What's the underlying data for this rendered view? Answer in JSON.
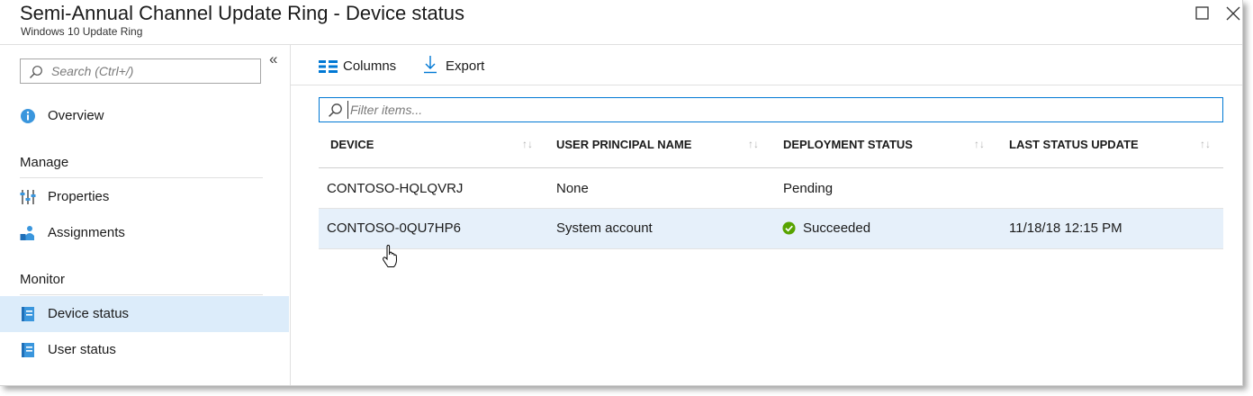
{
  "header": {
    "title": "Semi-Annual Channel Update Ring - Device status",
    "subtitle": "Windows 10 Update Ring"
  },
  "sidebar": {
    "search_placeholder": "Search (Ctrl+/)",
    "collapse_glyph": "«",
    "overview_label": "Overview",
    "sections": {
      "manage": "Manage",
      "monitor": "Monitor"
    },
    "items": [
      {
        "label": "Overview",
        "icon": "info-icon"
      },
      {
        "label": "Properties",
        "icon": "properties-icon"
      },
      {
        "label": "Assignments",
        "icon": "assignments-icon"
      },
      {
        "label": "Device status",
        "icon": "device-status-icon",
        "selected": true
      },
      {
        "label": "User status",
        "icon": "user-status-icon"
      }
    ]
  },
  "toolbar": {
    "columns_label": "Columns",
    "export_label": "Export"
  },
  "filter": {
    "placeholder": "Filter items..."
  },
  "table": {
    "columns": [
      "DEVICE",
      "USER PRINCIPAL NAME",
      "DEPLOYMENT STATUS",
      "LAST STATUS UPDATE"
    ],
    "sort_glyph": "↑↓",
    "rows": [
      {
        "device": "CONTOSO-HQLQVRJ",
        "upn": "None",
        "status": "Pending",
        "status_icon": "",
        "last_update": ""
      },
      {
        "device": "CONTOSO-0QU7HP6",
        "upn": "System account",
        "status": "Succeeded",
        "status_icon": "check-circle-icon",
        "last_update": "11/18/18 12:15 PM"
      }
    ]
  },
  "colors": {
    "accent": "#0078d4",
    "selected_bg": "#dcecfa",
    "hover_row_bg": "#e6f0fa",
    "success": "#57a300"
  }
}
